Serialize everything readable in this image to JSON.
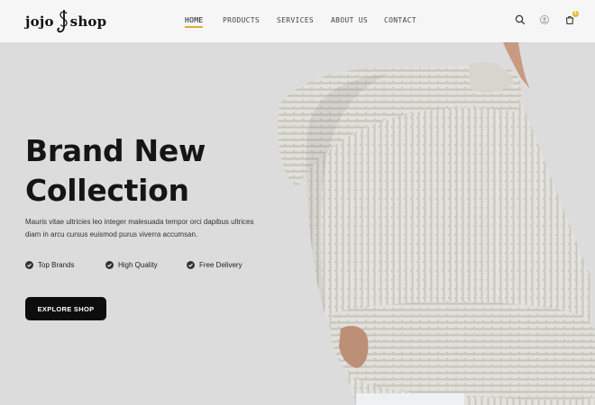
{
  "brand": {
    "name_left": "jojo",
    "name_right": "shop",
    "logo_icon": "js-monogram-icon"
  },
  "nav": {
    "items": [
      {
        "label": "HOME",
        "active": true
      },
      {
        "label": "PRODUCTS",
        "active": false
      },
      {
        "label": "SERVICES",
        "active": false
      },
      {
        "label": "ABOUT US",
        "active": false
      },
      {
        "label": "CONTACT",
        "active": false
      }
    ]
  },
  "header_icons": {
    "search": "search-icon",
    "account": "user-icon",
    "cart": "cart-icon",
    "cart_count": "1"
  },
  "hero": {
    "title_line1": "Brand New",
    "title_line2": "Collection",
    "description": "Mauris vitae ultricies leo integer malesuada tempor orci dapibus ultrices diam in arcu cursus euismod purus viverra accumsan.",
    "features": [
      {
        "label": "Top Brands",
        "icon": "check-circle-icon"
      },
      {
        "label": "High Quality",
        "icon": "check-circle-icon"
      },
      {
        "label": "Free Delivery",
        "icon": "check-circle-icon"
      }
    ],
    "cta_label": "EXPLORE SHOP",
    "image": "model-in-knit-sweater"
  },
  "colors": {
    "background": "#dcdcdc",
    "header": "#f6f6f6",
    "accent": "#e0a93a",
    "button": "#0d0d0d",
    "text": "#151515"
  }
}
